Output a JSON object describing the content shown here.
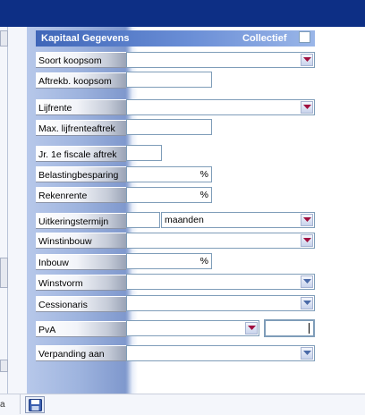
{
  "panel": {
    "title": "Kapitaal Gegevens",
    "collectief_label": "Collectief",
    "collectief_checked": false
  },
  "fields": {
    "soort_koopsom": {
      "label": "Soort koopsom",
      "value": ""
    },
    "aftrekb_koopsom": {
      "label": "Aftrekb. koopsom",
      "value": ""
    },
    "lijfrente": {
      "label": "Lijfrente",
      "value": ""
    },
    "max_lijfrenteaftrek": {
      "label": "Max. lijfrenteaftrek",
      "value": ""
    },
    "jr_fiscale_aftrek": {
      "label": "Jr. 1e fiscale aftrek",
      "value": ""
    },
    "belastingbesparing": {
      "label": "Belastingbesparing",
      "value": "",
      "suffix": "%"
    },
    "rekenrente": {
      "label": "Rekenrente",
      "value": "",
      "suffix": "%"
    },
    "uitkeringstermijn": {
      "label": "Uitkeringstermijn",
      "value": "",
      "unit_selected": "maanden"
    },
    "winstinbouw": {
      "label": "Winstinbouw",
      "value": ""
    },
    "inbouw": {
      "label": "Inbouw",
      "value": "",
      "suffix": "%"
    },
    "winstvorm": {
      "label": "Winstvorm",
      "value": ""
    },
    "cessionaris": {
      "label": "Cessionaris",
      "value": ""
    },
    "pva": {
      "label": "PvA",
      "value": "",
      "extra_value": ""
    },
    "verpanding_aan": {
      "label": "Verpanding aan",
      "value": ""
    }
  },
  "colors": {
    "topbar": "#0d2f85",
    "arrow_active": "#a01040",
    "arrow_inactive": "#4a6aa8"
  },
  "icons": {
    "dropdown": "chevron-down-icon",
    "save": "floppy-disk-icon"
  },
  "footer": {
    "corner_text": "a"
  }
}
